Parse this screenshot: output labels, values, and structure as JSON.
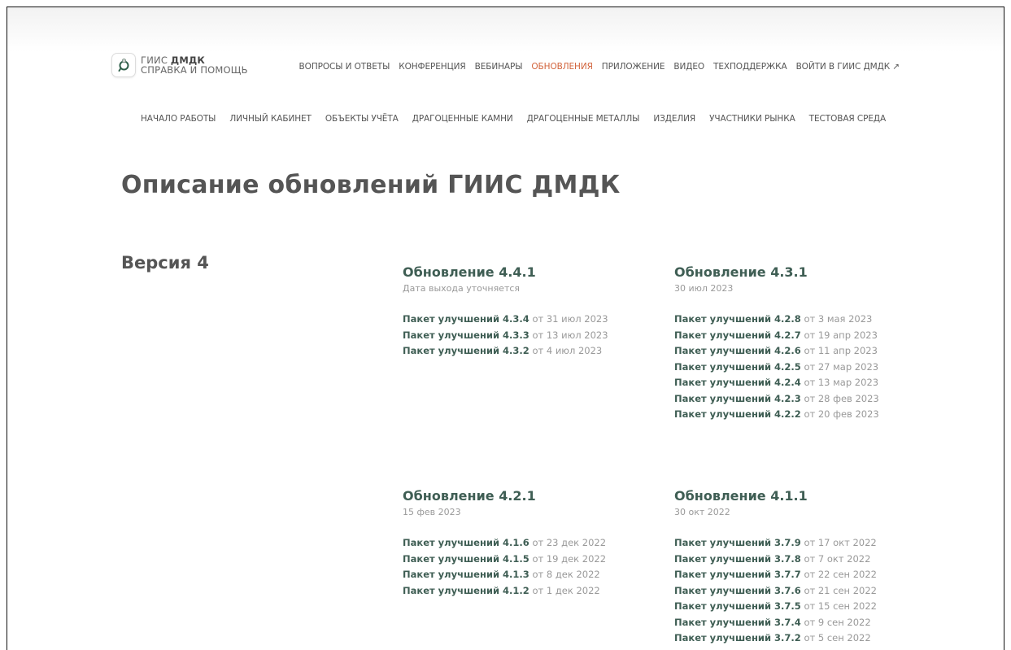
{
  "logo": {
    "line1_a": "ГИИС ",
    "line1_b": "ДМДК",
    "line2": "СПРАВКА И ПОМОЩЬ"
  },
  "top_nav": [
    {
      "label": "ВОПРОСЫ И ОТВЕТЫ"
    },
    {
      "label": "КОНФЕРЕНЦИЯ"
    },
    {
      "label": "ВЕБИНАРЫ"
    },
    {
      "label": "ОБНОВЛЕНИЯ",
      "active": true
    },
    {
      "label": "ПРИЛОЖЕНИЕ"
    },
    {
      "label": "ВИДЕО"
    },
    {
      "label": "ТЕХПОДДЕРЖКА"
    },
    {
      "label": "ВОЙТИ В ГИИС ДМДК ↗"
    }
  ],
  "sub_nav": [
    {
      "label": "НАЧАЛО РАБОТЫ"
    },
    {
      "label": "ЛИЧНЫЙ КАБИНЕТ"
    },
    {
      "label": "ОБЪЕКТЫ УЧЁТА"
    },
    {
      "label": "ДРАГОЦЕННЫЕ КАМНИ"
    },
    {
      "label": "ДРАГОЦЕННЫЕ МЕТАЛЛЫ"
    },
    {
      "label": "ИЗДЕЛИЯ"
    },
    {
      "label": "УЧАСТНИКИ РЫНКА"
    },
    {
      "label": "ТЕСТОВАЯ СРЕДА"
    }
  ],
  "page_title": "Описание обновлений ГИИС ДМДК",
  "version_title": "Версия 4",
  "updates": [
    {
      "title": "Обновление 4.4.1",
      "date": "Дата выхода уточняется",
      "packages": [
        {
          "name": "Пакет улучшений 4.3.4",
          "date": " от 31 июл 2023"
        },
        {
          "name": "Пакет улучшений 4.3.3",
          "date": " от 13 июл 2023"
        },
        {
          "name": "Пакет улучшений 4.3.2",
          "date": " от 4 июл 2023"
        }
      ]
    },
    {
      "title": "Обновление 4.3.1",
      "date": "30 июл 2023",
      "packages": [
        {
          "name": "Пакет улучшений 4.2.8",
          "date": " от 3 мая 2023"
        },
        {
          "name": "Пакет улучшений 4.2.7",
          "date": " от 19 апр 2023"
        },
        {
          "name": "Пакет улучшений 4.2.6",
          "date": " от 11 апр 2023"
        },
        {
          "name": "Пакет улучшений 4.2.5",
          "date": " от 27 мар 2023"
        },
        {
          "name": "Пакет улучшений 4.2.4",
          "date": " от 13 мар 2023"
        },
        {
          "name": "Пакет улучшений 4.2.3",
          "date": " от 28 фев 2023"
        },
        {
          "name": "Пакет улучшений 4.2.2",
          "date": " от 20 фев 2023"
        }
      ]
    },
    {
      "title": "Обновление 4.2.1",
      "date": "15 фев 2023",
      "packages": [
        {
          "name": "Пакет улучшений 4.1.6",
          "date": " от 23 дек 2022"
        },
        {
          "name": "Пакет улучшений 4.1.5",
          "date": " от 19 дек 2022"
        },
        {
          "name": "Пакет улучшений 4.1.3",
          "date": " от 8 дек 2022"
        },
        {
          "name": "Пакет улучшений 4.1.2",
          "date": " от 1 дек 2022"
        }
      ]
    },
    {
      "title": "Обновление 4.1.1",
      "date": "30 окт 2022",
      "packages": [
        {
          "name": "Пакет улучшений 3.7.9",
          "date": " от 17 окт 2022"
        },
        {
          "name": "Пакет улучшений 3.7.8",
          "date": " от 7 окт 2022"
        },
        {
          "name": "Пакет улучшений 3.7.7",
          "date": " от 22 сен 2022"
        },
        {
          "name": "Пакет улучшений 3.7.6",
          "date": " от 21 сен 2022"
        },
        {
          "name": "Пакет улучшений 3.7.5",
          "date": " от 15 сен 2022"
        },
        {
          "name": "Пакет улучшений 3.7.4",
          "date": " от 9 сен 2022"
        },
        {
          "name": "Пакет улучшений 3.7.2",
          "date": " от 5 сен 2022"
        }
      ]
    }
  ]
}
